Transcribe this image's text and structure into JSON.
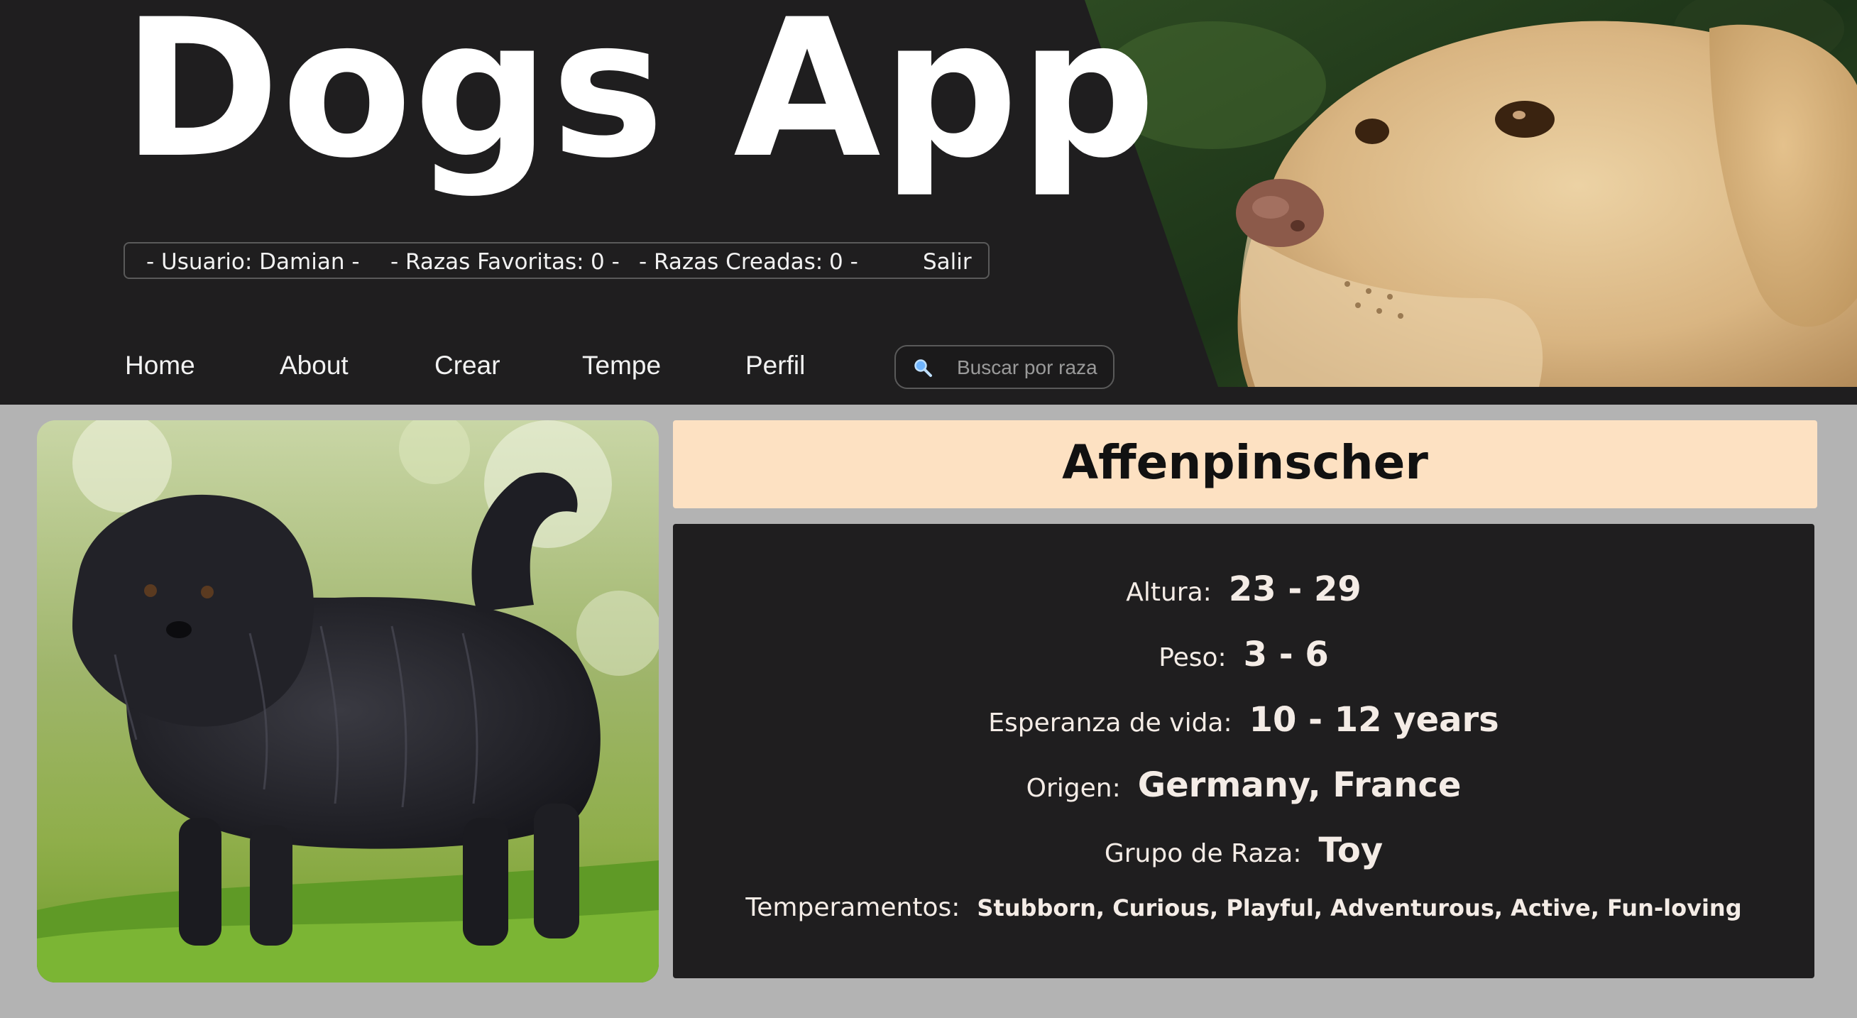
{
  "app": {
    "title": "Dogs App"
  },
  "user_bar": {
    "usuario": "- Usuario: Damian -",
    "favoritas_label": "- Razas Favoritas:",
    "favoritas_count": "0 -",
    "creadas_label": "- Razas Creadas:",
    "creadas_count": "0 -",
    "salir": "Salir"
  },
  "nav": {
    "items": [
      {
        "label": "Home"
      },
      {
        "label": "About"
      },
      {
        "label": "Crear"
      },
      {
        "label": "Tempe"
      },
      {
        "label": "Perfil"
      }
    ]
  },
  "search": {
    "placeholder": "Buscar por raza",
    "value": ""
  },
  "breed": {
    "name": "Affenpinscher",
    "details": [
      {
        "label": "Altura:",
        "value": "23 - 29"
      },
      {
        "label": "Peso:",
        "value": "3 - 6"
      },
      {
        "label": "Esperanza de vida:",
        "value": "10 - 12 years"
      },
      {
        "label": "Origen:",
        "value": "Germany, France"
      },
      {
        "label": "Grupo de Raza:",
        "value": "Toy"
      },
      {
        "label": "Temperamentos:",
        "value": "Stubborn, Curious, Playful, Adventurous, Active, Fun-loving"
      }
    ]
  },
  "colors": {
    "header_bg": "#1f1e1f",
    "page_bg": "#b3b3b3",
    "banner_bg": "#fde1c2",
    "text_light": "#f4ece6"
  },
  "icons": {
    "search": "search-icon"
  }
}
